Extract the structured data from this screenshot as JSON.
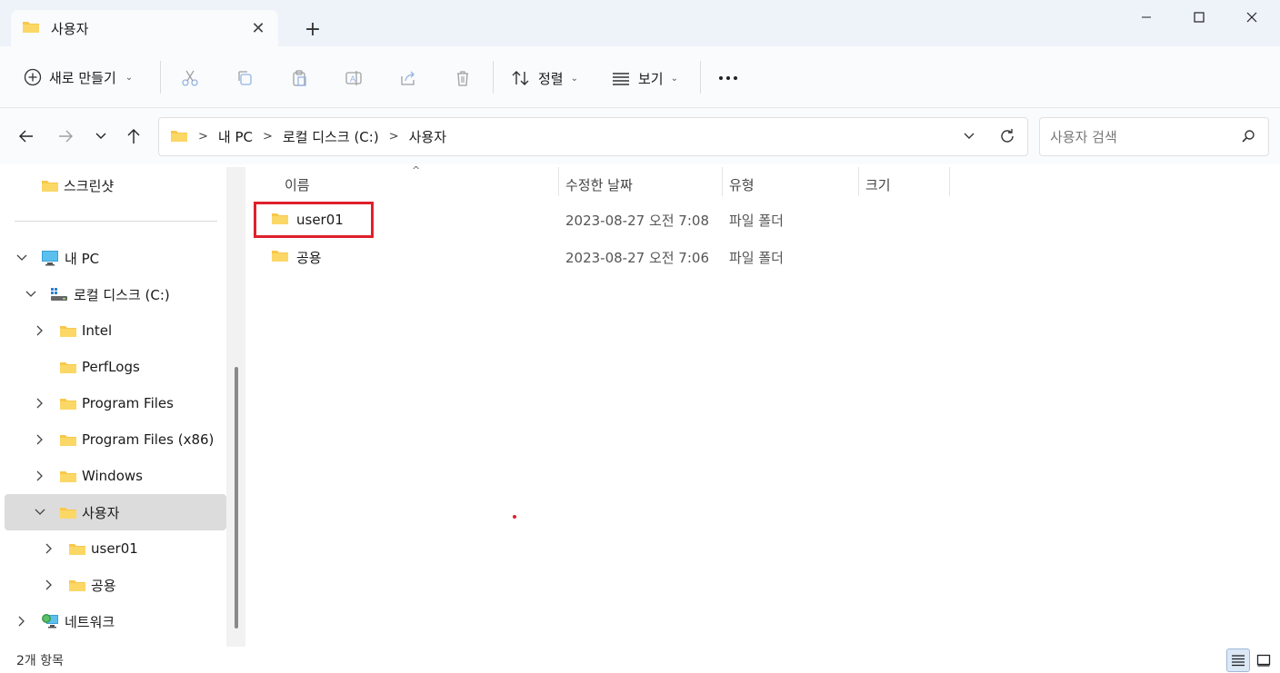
{
  "window": {
    "tab_title": "사용자"
  },
  "toolbar": {
    "new_label": "새로 만들기",
    "sort_label": "정렬",
    "view_label": "보기"
  },
  "address": {
    "crumbs": [
      "내 PC",
      "로컬 디스크 (C:)",
      "사용자"
    ]
  },
  "search": {
    "placeholder": "사용자 검색"
  },
  "sidebar": {
    "items": [
      {
        "label": "스크린샷"
      },
      {
        "label": "내 PC"
      },
      {
        "label": "로컬 디스크 (C:)"
      },
      {
        "label": "Intel"
      },
      {
        "label": "PerfLogs"
      },
      {
        "label": "Program Files"
      },
      {
        "label": "Program Files (x86)"
      },
      {
        "label": "Windows"
      },
      {
        "label": "사용자"
      },
      {
        "label": "user01"
      },
      {
        "label": "공용"
      },
      {
        "label": "네트워크"
      }
    ]
  },
  "columns": {
    "name": "이름",
    "date": "수정한 날짜",
    "type": "유형",
    "size": "크기"
  },
  "files": [
    {
      "name": "user01",
      "date": "2023-08-27 오전 7:08",
      "type": "파일 폴더"
    },
    {
      "name": "공용",
      "date": "2023-08-27 오전 7:06",
      "type": "파일 폴더"
    }
  ],
  "status": {
    "count": "2개 항목"
  },
  "colors": {
    "folder": "#f8c84a",
    "highlight": "#e0202c",
    "selected": "#dcdcdc"
  }
}
